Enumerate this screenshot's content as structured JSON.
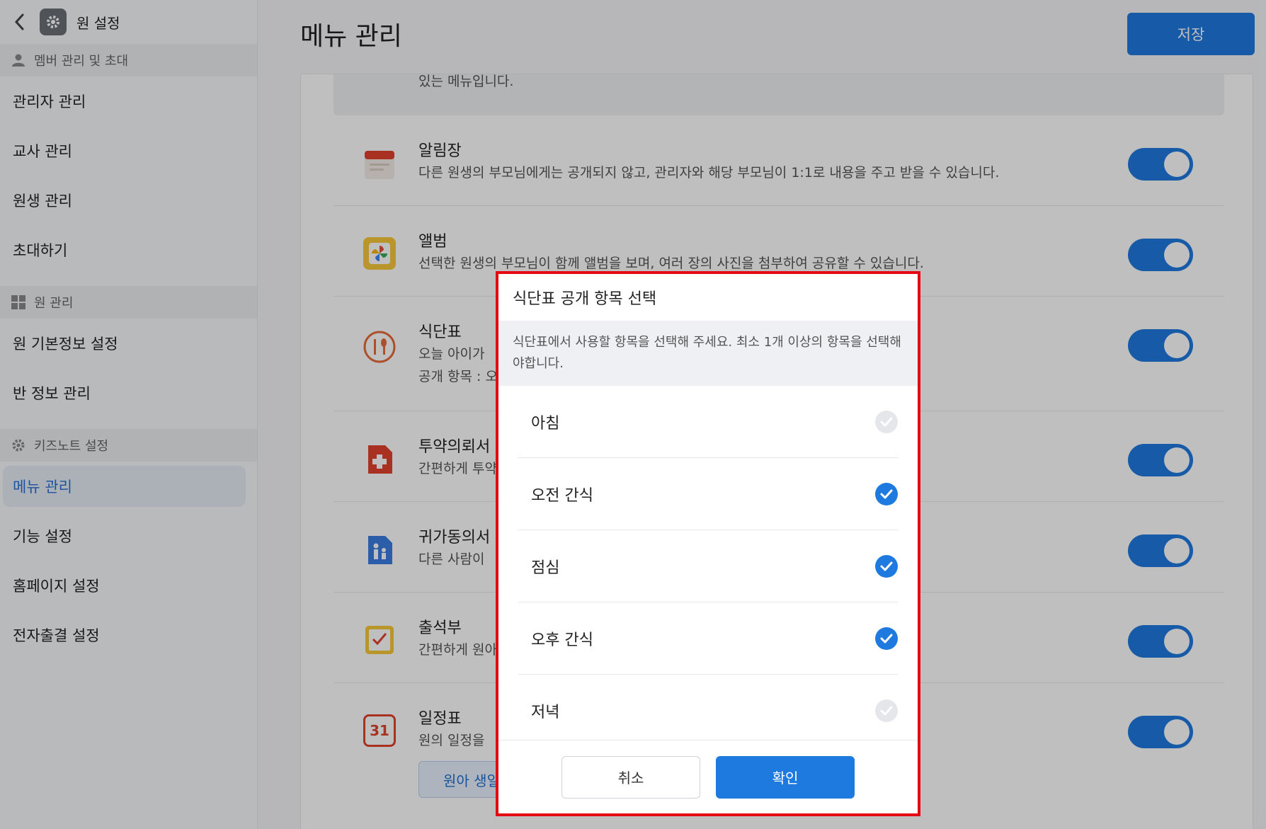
{
  "sidebar": {
    "title": "원 설정",
    "sections": [
      {
        "label": "멤버 관리 및 초대",
        "icon": "person-icon"
      },
      {
        "label": "원 관리",
        "icon": "grid-icon"
      },
      {
        "label": "키즈노트 설정",
        "icon": "gear-icon"
      }
    ],
    "items": [
      {
        "label": "관리자 관리"
      },
      {
        "label": "교사 관리"
      },
      {
        "label": "원생 관리"
      },
      {
        "label": "초대하기"
      },
      {
        "label": "원 기본정보 설정"
      },
      {
        "label": "반 정보 관리"
      },
      {
        "label": "메뉴 관리"
      },
      {
        "label": "기능 설정"
      },
      {
        "label": "홈페이지 설정"
      },
      {
        "label": "전자출결 설정"
      }
    ],
    "active_item": "메뉴 관리"
  },
  "header": {
    "title": "메뉴 관리",
    "save_label": "저장"
  },
  "notice": {
    "text": "있는 메뉴입니다."
  },
  "menus": [
    {
      "title": "알림장",
      "desc": "다른 원생의 부모님에게는 공개되지 않고, 관리자와 해당 부모님이 1:1로 내용을 주고 받을 수 있습니다.",
      "icon": "notebook-icon",
      "enabled": true
    },
    {
      "title": "앨범",
      "desc": "선택한 원생의 부모님이 함께 앨범을 보며, 여러 장의 사진을 첨부하여 공유할 수 있습니다.",
      "icon": "pinwheel-icon",
      "enabled": true
    },
    {
      "title": "식단표",
      "desc": "오늘 아이가",
      "desc2": "공개 항목 : 오",
      "icon": "utensils-icon",
      "enabled": true
    },
    {
      "title": "투약의뢰서",
      "desc": "간편하게 투약",
      "icon": "medical-icon",
      "enabled": true
    },
    {
      "title": "귀가동의서",
      "desc": "다른 사람이",
      "icon": "family-icon",
      "enabled": true
    },
    {
      "title": "출석부",
      "desc": "간편하게 원아",
      "icon": "attendance-icon",
      "enabled": true
    },
    {
      "title": "일정표",
      "desc": "원의 일정을",
      "chip": "원아 생일",
      "icon": "calendar-icon",
      "icon_text": "31",
      "enabled": true
    }
  ],
  "modal": {
    "title": "식단표 공개 항목 선택",
    "desc": "식단표에서 사용할 항목을 선택해 주세요. 최소 1개 이상의 항목을 선택해야합니다.",
    "options": [
      {
        "label": "아침",
        "checked": false
      },
      {
        "label": "오전 간식",
        "checked": true
      },
      {
        "label": "점심",
        "checked": true
      },
      {
        "label": "오후 간식",
        "checked": true
      },
      {
        "label": "저녁",
        "checked": false
      }
    ],
    "cancel_label": "취소",
    "ok_label": "확인"
  },
  "colors": {
    "accent": "#1f7ae0",
    "highlight_border": "#e50914"
  }
}
